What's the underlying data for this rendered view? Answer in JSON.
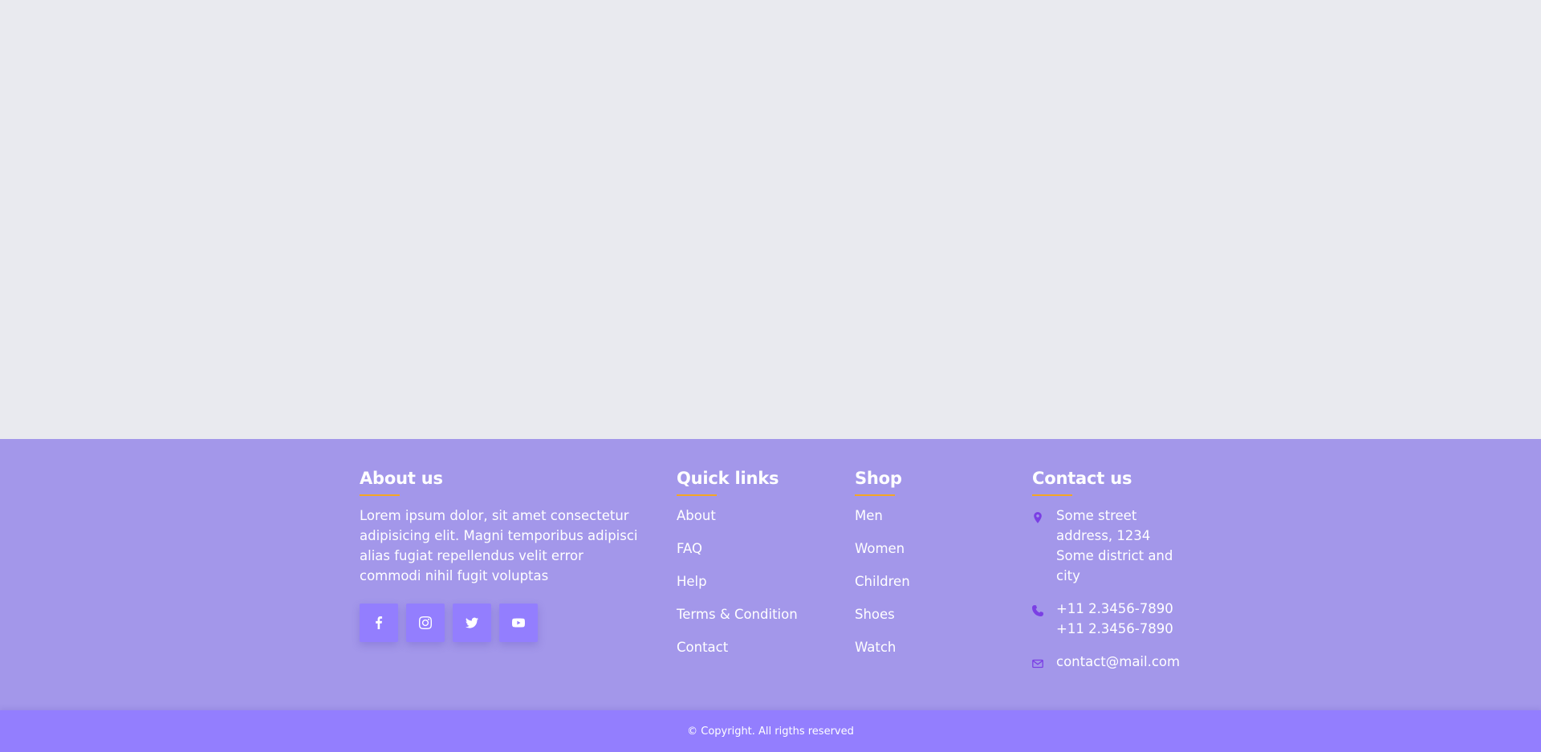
{
  "footer": {
    "about": {
      "title": "About us",
      "text": "Lorem ipsum dolor, sit amet consectetur adipisicing elit. Magni temporibus adipisci alias fugiat repellendus velit error commodi nihil fugit voluptas",
      "social": [
        {
          "icon": "facebook-icon"
        },
        {
          "icon": "instagram-icon"
        },
        {
          "icon": "twitter-icon"
        },
        {
          "icon": "youtube-icon"
        }
      ]
    },
    "quick_links": {
      "title": "Quick links",
      "items": [
        "About",
        "FAQ",
        "Help",
        "Terms & Condition",
        "Contact"
      ]
    },
    "shop": {
      "title": "Shop",
      "items": [
        "Men",
        "Women",
        "Children",
        "Shoes",
        "Watch"
      ]
    },
    "contact": {
      "title": "Contact us",
      "address": "Some street address, 1234 Some district and city",
      "phone1": "+11 2.3456-7890",
      "phone2": "+11 2.3456-7890",
      "email": "contact@mail.com"
    },
    "copyright": "© Copyright. All rigths reserved"
  },
  "colors": {
    "page_bg": "#e9eaef",
    "footer_bg": "#a397ea",
    "accent": "#937efe",
    "underline": "#f5a623",
    "contact_icon": "#7b3fe4"
  }
}
